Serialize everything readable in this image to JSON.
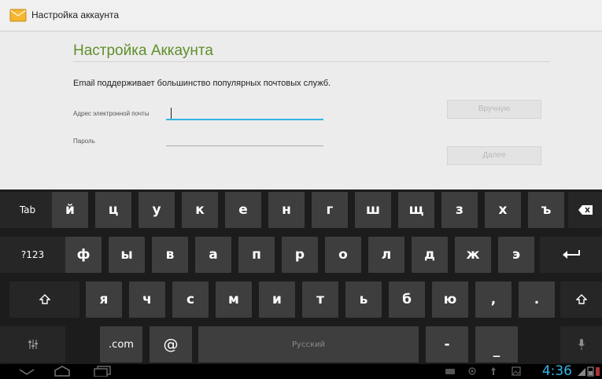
{
  "app": {
    "title": "Настройка аккаунта"
  },
  "form": {
    "heading": "Настройка Аккаунта",
    "description": "Email поддерживает большинство популярных почтовых служб.",
    "email_label": "Адрес электронной почты",
    "email_value": "",
    "password_label": "Пароль",
    "password_value": "",
    "manual_button": "Вручную",
    "next_button": "Далее"
  },
  "keyboard": {
    "row1": [
      "й",
      "ц",
      "у",
      "к",
      "е",
      "н",
      "г",
      "ш",
      "щ",
      "з",
      "х",
      "ъ"
    ],
    "row2": [
      "ф",
      "ы",
      "в",
      "а",
      "п",
      "р",
      "о",
      "л",
      "д",
      "ж",
      "э"
    ],
    "row3": [
      "я",
      "ч",
      "с",
      "м",
      "и",
      "т",
      "ь",
      "б",
      "ю",
      ",",
      "."
    ],
    "tab_label": "Tab",
    "symbols_label": "?123",
    "dotcom_label": ".com",
    "at_label": "@",
    "space_label": "Русский",
    "dash_label": "-",
    "underscore_label": "_",
    "icons": {
      "backspace": "backspace-icon",
      "enter": "enter-icon",
      "shift": "shift-icon",
      "settings": "keyboard-settings-icon",
      "mic": "microphone-icon"
    }
  },
  "status": {
    "time": "4:36"
  },
  "colors": {
    "accent": "#33b5e5",
    "heading": "#5f8f2c",
    "key": "#3e3e3e",
    "keyboard_bg": "#1c1c1c"
  }
}
